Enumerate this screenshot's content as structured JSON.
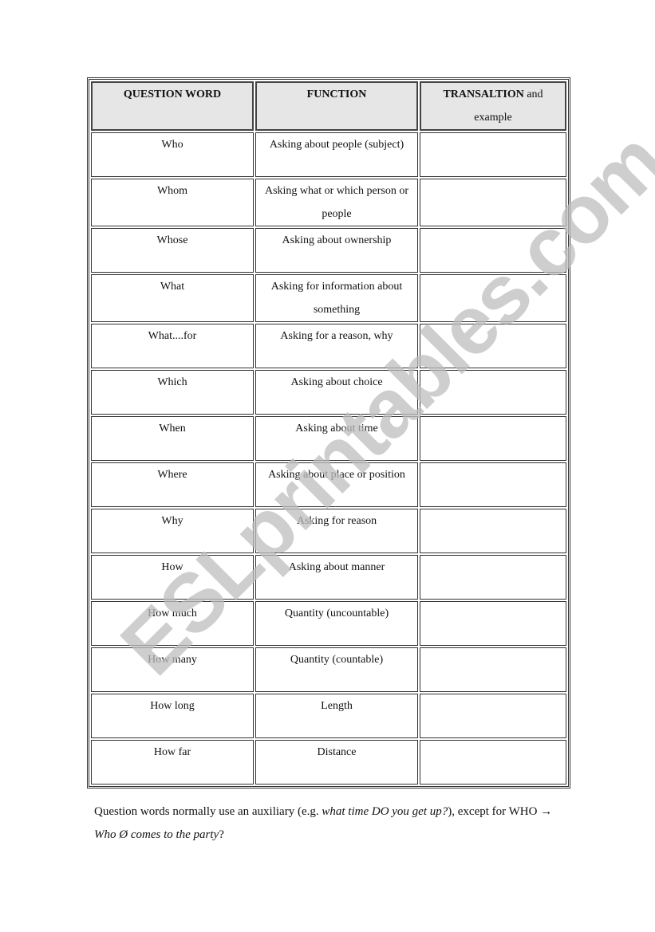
{
  "table": {
    "headers": {
      "col1": "QUESTION WORD",
      "col2": "FUNCTION",
      "col3_bold": "TRANSALTION",
      "col3_rest": " and example"
    },
    "rows": [
      {
        "word": "Who",
        "function": "Asking about people (subject)",
        "translation": ""
      },
      {
        "word": "Whom",
        "function": "Asking what or which person or people",
        "translation": ""
      },
      {
        "word": "Whose",
        "function": "Asking about ownership",
        "translation": ""
      },
      {
        "word": "What",
        "function": "Asking for information about something",
        "translation": ""
      },
      {
        "word": "What....for",
        "function": "Asking for a reason, why",
        "translation": ""
      },
      {
        "word": "Which",
        "function": "Asking about choice",
        "translation": ""
      },
      {
        "word": "When",
        "function": "Asking about time",
        "translation": ""
      },
      {
        "word": "Where",
        "function": "Asking about place or position",
        "translation": ""
      },
      {
        "word": "Why",
        "function": "Asking for reason",
        "translation": ""
      },
      {
        "word": "How",
        "function": "Asking about manner",
        "translation": ""
      },
      {
        "word": "How much",
        "function": "Quantity (uncountable)",
        "translation": ""
      },
      {
        "word": "How many",
        "function": "Quantity (countable)",
        "translation": ""
      },
      {
        "word": "How long",
        "function": "Length",
        "translation": ""
      },
      {
        "word": "How far",
        "function": "Distance",
        "translation": ""
      }
    ]
  },
  "note": {
    "part1": "Question words normally use an auxiliary (e.g. ",
    "example1": "what time DO you get up?",
    "part2": "), except for WHO ",
    "arrow": "→",
    "example2": " Who Ø comes to the party",
    "part3": "?"
  },
  "watermark": "ESLprintables.com"
}
